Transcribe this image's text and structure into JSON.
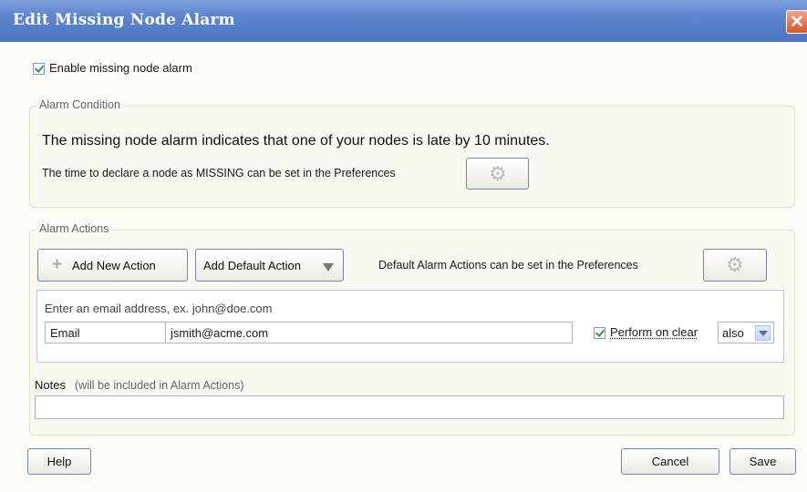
{
  "window": {
    "title": "Edit Missing Node Alarm",
    "close_glyph": "✕"
  },
  "enable": {
    "label": "Enable missing node alarm",
    "checked": true
  },
  "condition": {
    "legend": "Alarm Condition",
    "description": "The missing node alarm indicates that one of your nodes is late by 10 minutes.",
    "prefs_text": "The time to declare a node as MISSING can be set in the Preferences",
    "prefs_button_icon": "gear-icon"
  },
  "actions": {
    "legend": "Alarm Actions",
    "add_new_label": "Add New Action",
    "add_new_icon": "plus-icon",
    "add_default_label": "Add Default Action",
    "defaults_text": "Default Alarm Actions can be set in the Preferences",
    "prefs_button_icon": "gear-icon",
    "action": {
      "hint": "Enter an email address, ex. john@doe.com",
      "type_value": "Email",
      "address_value": "jsmith@acme.com",
      "perform_on_clear_label": "Perform on clear",
      "perform_on_clear_checked": true,
      "clear_mode_value": "also"
    },
    "notes": {
      "label": "Notes",
      "sublabel": "(will be included in Alarm Actions)",
      "value": ""
    }
  },
  "footer": {
    "help_label": "Help",
    "cancel_label": "Cancel",
    "save_label": "Save"
  }
}
